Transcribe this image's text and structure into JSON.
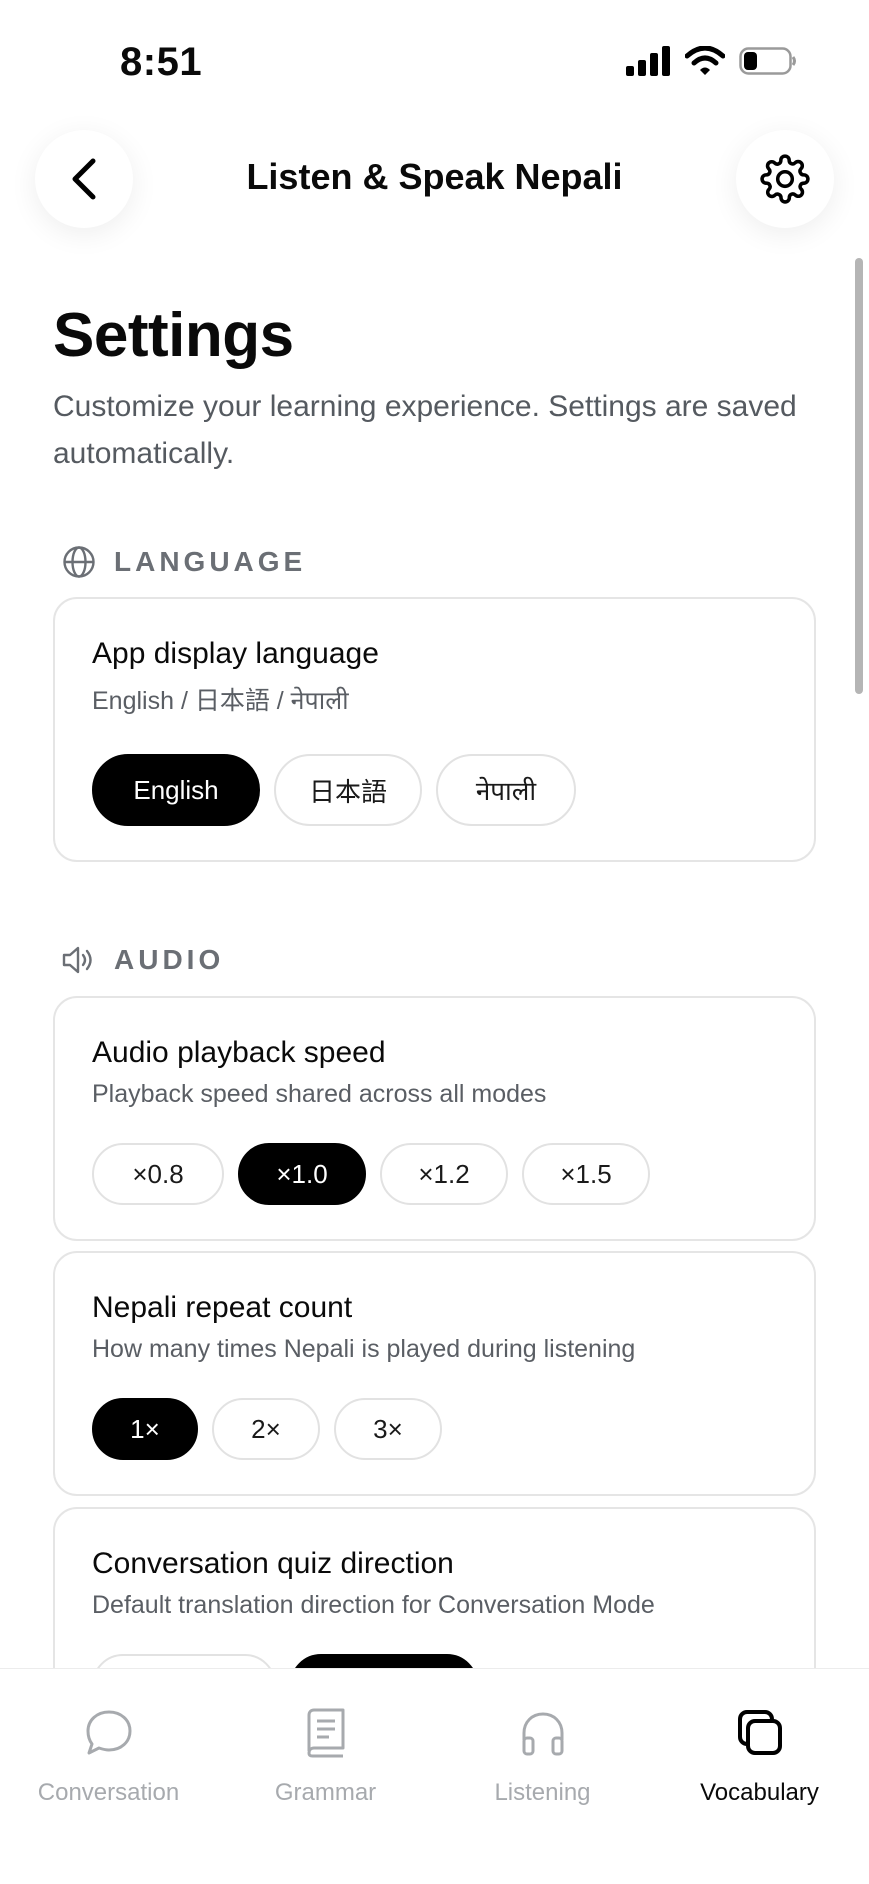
{
  "status_bar": {
    "time": "8:51"
  },
  "header": {
    "title": "Listen & Speak Nepali"
  },
  "page": {
    "title": "Settings",
    "subtitle": "Customize your learning experience. Settings are saved automatically."
  },
  "sections": {
    "language": {
      "label": "LANGUAGE"
    },
    "audio": {
      "label": "AUDIO"
    }
  },
  "cards": {
    "display_language": {
      "title": "App display language",
      "description": "English / 日本語 / नेपाली",
      "options": [
        "English",
        "日本語",
        "नेपाली"
      ],
      "selected": "English"
    },
    "playback_speed": {
      "title": "Audio playback speed",
      "description": "Playback speed shared across all modes",
      "options": [
        "×0.8",
        "×1.0",
        "×1.2",
        "×1.5"
      ],
      "selected": "×1.0"
    },
    "repeat_count": {
      "title": "Nepali repeat count",
      "description": "How many times Nepali is played during listening",
      "options": [
        "1×",
        "2×",
        "3×"
      ],
      "selected": "1×"
    },
    "quiz_direction": {
      "title": "Conversation quiz direction",
      "description": "Default translation direction for Conversation Mode"
    }
  },
  "tab_bar": {
    "tabs": [
      {
        "label": "Conversation",
        "icon": "chat-bubble-icon",
        "active": false
      },
      {
        "label": "Grammar",
        "icon": "book-icon",
        "active": false
      },
      {
        "label": "Listening",
        "icon": "headphones-icon",
        "active": false
      },
      {
        "label": "Vocabulary",
        "icon": "cards-stack-icon",
        "active": true
      }
    ]
  },
  "colors": {
    "accent": "#000000",
    "muted_text": "#5a5e64",
    "border": "#e5e5e5",
    "inactive_tab": "#a7aaae"
  }
}
